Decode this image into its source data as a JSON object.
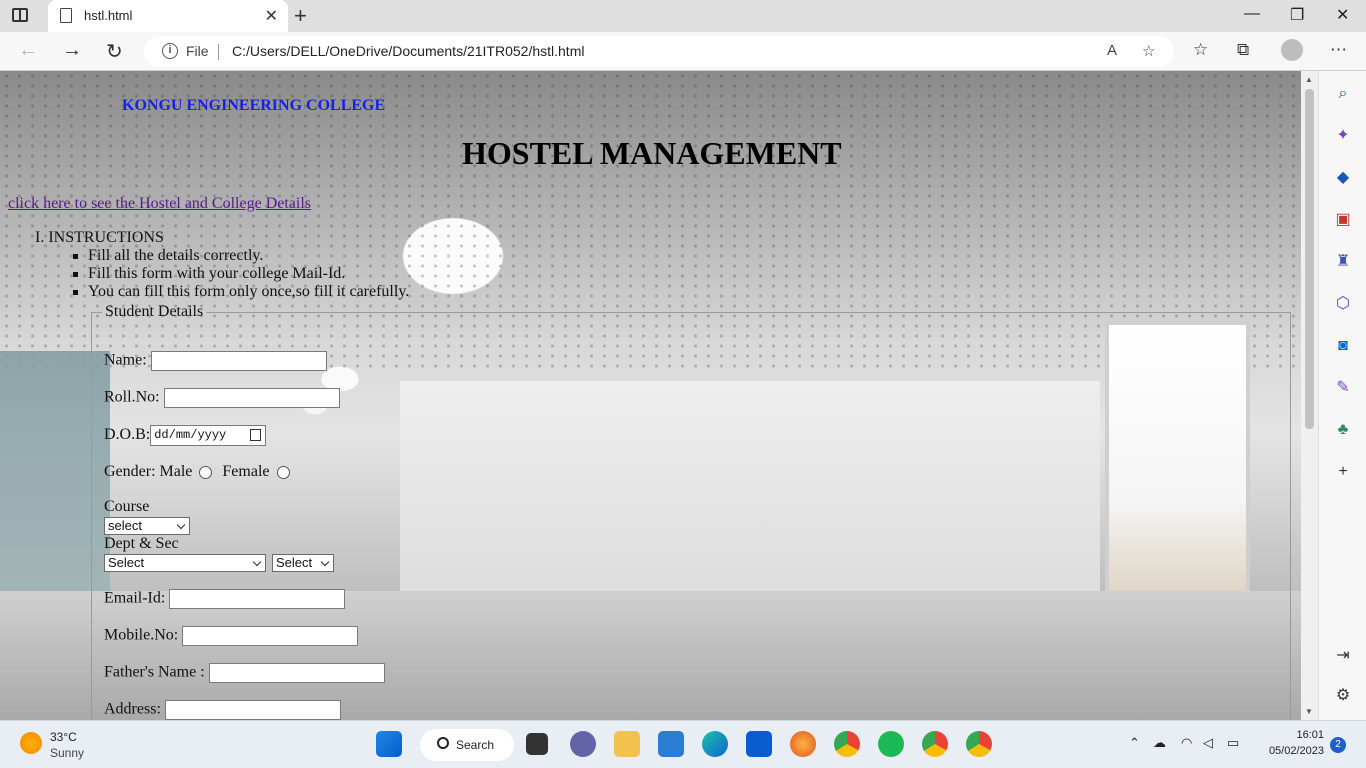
{
  "browser": {
    "tab_title": "hstl.html",
    "address_prefix": "File",
    "url": "C:/Users/DELL/OneDrive/Documents/21ITR052/hstl.html"
  },
  "page": {
    "college_name": "KONGU ENGINEERING COLLEGE",
    "heading": "HOSTEL MANAGEMENT",
    "details_link": "click here to see the Hostel and College Details",
    "instructions_title": "I. INSTRUCTIONS",
    "instructions": [
      "Fill all the details correctly.",
      "Fill this form with your college Mail-Id.",
      "You can fill this form only once,so fill it carefully."
    ],
    "form": {
      "legend": "Student Details",
      "name_label": "Name:",
      "roll_label": "Roll.No:",
      "dob_label": "D.O.B:",
      "dob_placeholder": "dd/mm/yyyy",
      "gender_label": "Gender:",
      "male_label": "Male",
      "female_label": "Female",
      "course_label": "Course",
      "course_value": "select",
      "dept_label": "Dept & Sec",
      "dept_value": "Select",
      "sec_value": "Select",
      "email_label": "Email-Id:",
      "mobile_label": "Mobile.No:",
      "father_label": "Father's Name :",
      "address_label": "Address:"
    }
  },
  "taskbar": {
    "temperature": "33°C",
    "condition": "Sunny",
    "search_label": "Search",
    "time": "16:01",
    "date": "05/02/2023",
    "notifications": "2"
  },
  "colors": {
    "college_name": "#1a20e0",
    "link_visited": "#551a8b",
    "accent": "#0a64d6"
  }
}
